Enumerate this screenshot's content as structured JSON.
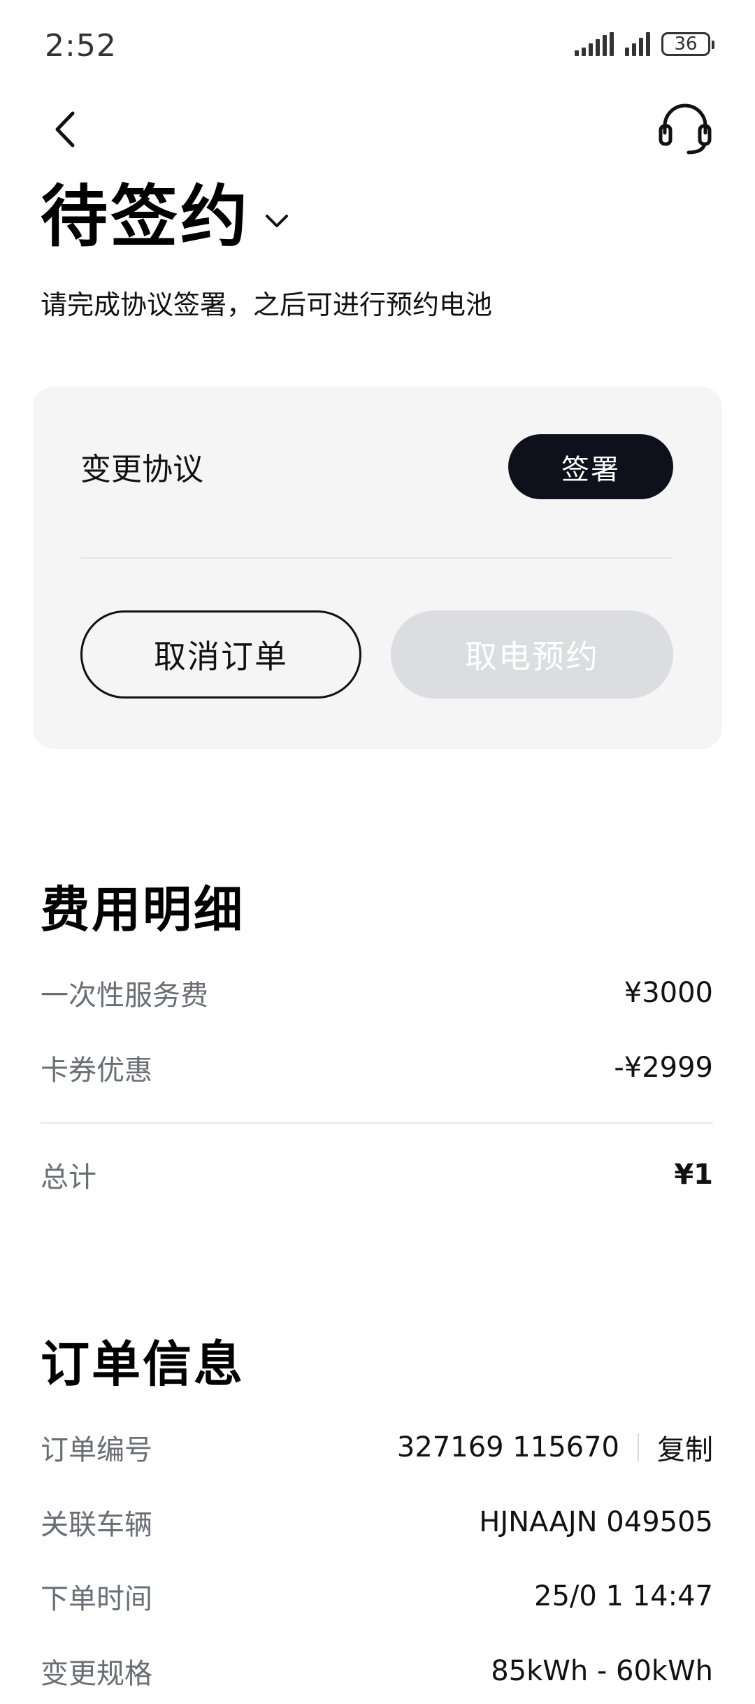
{
  "status_bar": {
    "time": "2:52",
    "battery": "36"
  },
  "header": {
    "title": "待签约",
    "subtitle": "请完成协议签署，之后可进行预约电池"
  },
  "agreement_card": {
    "label": "变更协议",
    "sign_button": "签署",
    "cancel_button": "取消订单",
    "reserve_button": "取电预约"
  },
  "fees": {
    "title": "费用明细",
    "rows": [
      {
        "label": "一次性服务费",
        "value": "¥3000"
      },
      {
        "label": "卡券优惠",
        "value": "-¥2999"
      }
    ],
    "total": {
      "label": "总计",
      "value": "¥1"
    }
  },
  "order_info": {
    "title": "订单信息",
    "order_number": {
      "label": "订单编号",
      "value": "327169 115670",
      "copy": "复制"
    },
    "vehicle": {
      "label": "关联车辆",
      "value": "HJNAAJN 049505"
    },
    "order_time": {
      "label": "下单时间",
      "value": "25/0 1 14:47"
    },
    "spec_change": {
      "label": "变更规格",
      "value": "85kWh - 60kWh"
    }
  },
  "colors": {
    "primary_dark": "#0e111c",
    "disabled": "#dcdde1",
    "card_bg": "#f5f5f6",
    "label_gray": "#6b6d75"
  },
  "icons": [
    "back-arrow-icon",
    "headset-icon",
    "chevron-down-icon",
    "signal-icon",
    "battery-icon"
  ]
}
